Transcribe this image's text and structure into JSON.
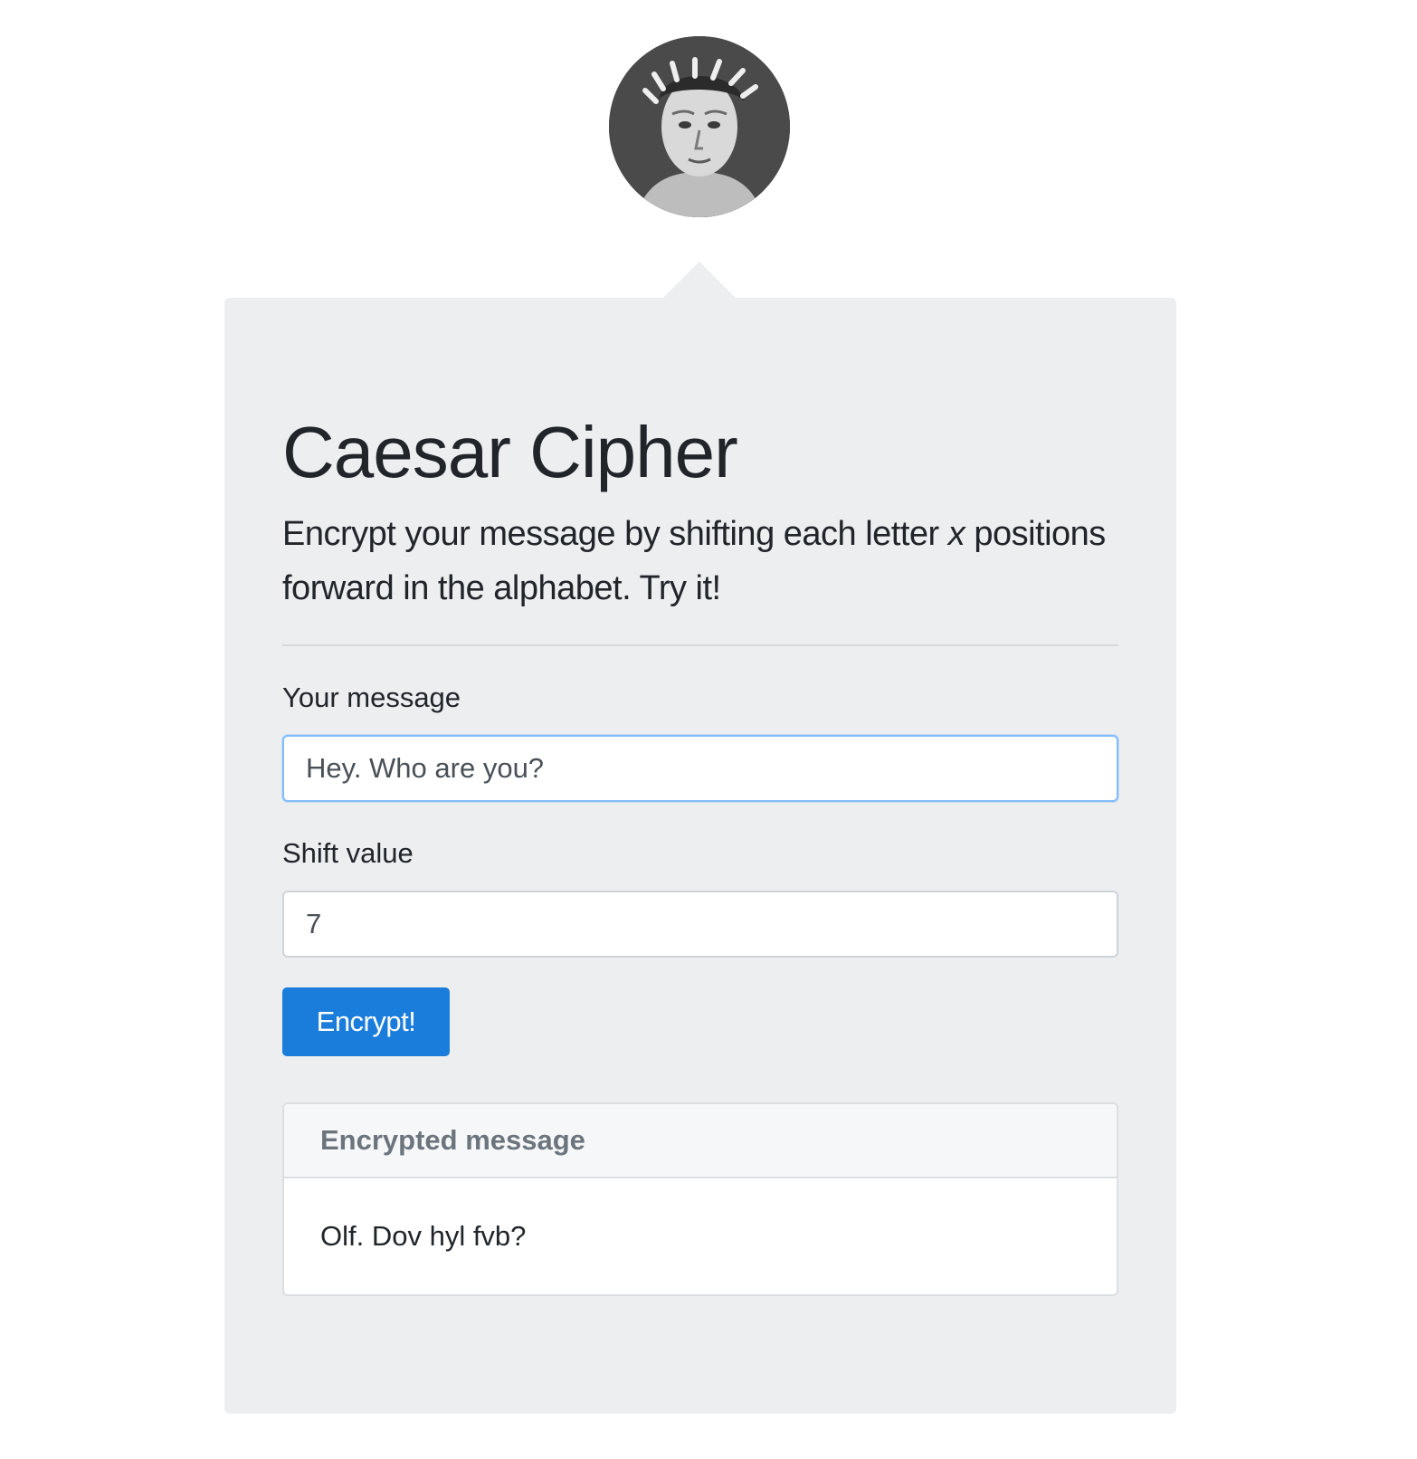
{
  "header": {
    "title": "Caesar Cipher",
    "lead_before": "Encrypt your message by shifting each letter ",
    "lead_variable": "x",
    "lead_after": " positions forward in the alphabet. Try it!"
  },
  "form": {
    "message_label": "Your message",
    "message_value": "Hey. Who are you?",
    "shift_label": "Shift value",
    "shift_value": "7",
    "submit_label": "Encrypt!"
  },
  "result": {
    "header": "Encrypted message",
    "value": "Olf. Dov hyl fvb?"
  },
  "colors": {
    "card_background": "#eceef0",
    "primary_button": "#1a7cdb",
    "focused_input_border": "#80bdff"
  },
  "icons": {
    "avatar": "caesar-portrait-icon"
  }
}
